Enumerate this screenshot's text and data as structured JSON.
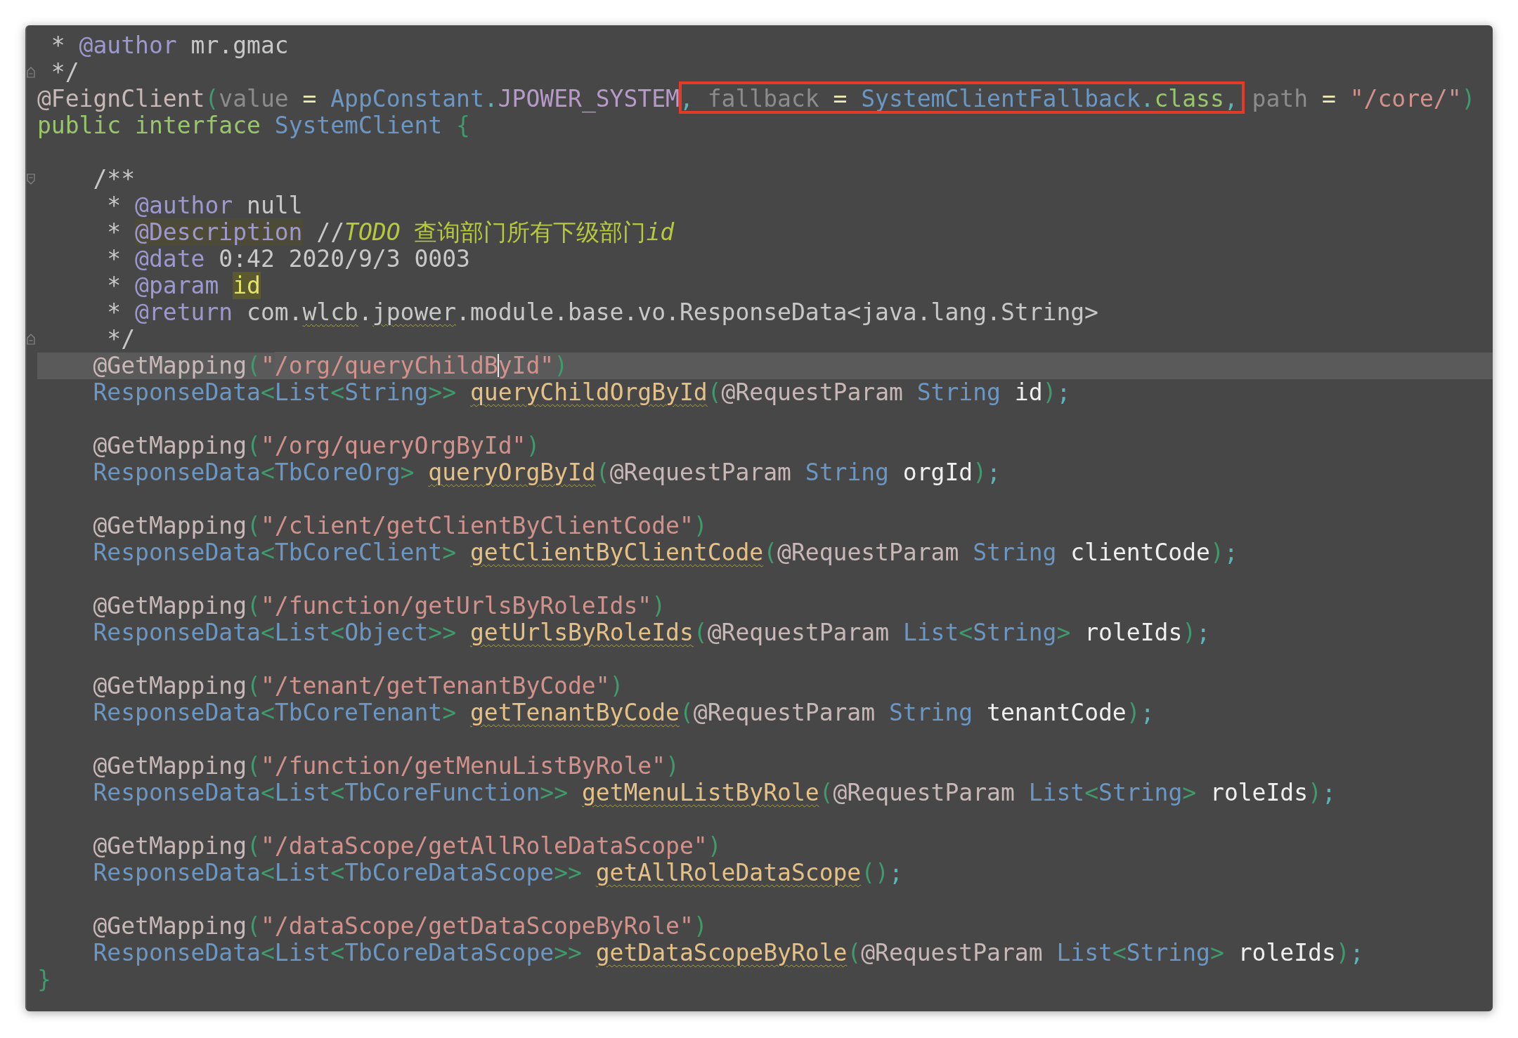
{
  "editor": {
    "lines": [
      {
        "kind": "code",
        "current": false,
        "tokens": [
          {
            "t": " * ",
            "kind": "doc"
          },
          {
            "t": "@author",
            "kind": "tag"
          },
          {
            "t": " mr.gmac",
            "kind": "doc"
          }
        ]
      },
      {
        "kind": "code",
        "current": false,
        "fold_end": true,
        "tokens": [
          {
            "t": " */",
            "kind": "doc"
          }
        ]
      },
      {
        "kind": "code",
        "current": false,
        "tokens": [
          {
            "t": "@FeignClient",
            "kind": "ann"
          },
          {
            "t": "(",
            "kind": "paren"
          },
          {
            "t": "value",
            "kind": "attr"
          },
          {
            "t": " = ",
            "kind": "op"
          },
          {
            "t": "AppConstant",
            "kind": "type"
          },
          {
            "t": ".",
            "kind": "dot"
          },
          {
            "t": "JPOWER_SYSTEM",
            "kind": "const"
          },
          {
            "kind": "group",
            "boxed": true,
            "tokens": [
              {
                "t": ",",
                "kind": "dot"
              },
              {
                "t": " fallback",
                "kind": "attr"
              },
              {
                "t": " = ",
                "kind": "op"
              },
              {
                "t": "SystemClientFallback",
                "kind": "type"
              },
              {
                "t": ".",
                "kind": "dot"
              },
              {
                "t": "class",
                "kind": "kw"
              },
              {
                "t": ",",
                "kind": "dot"
              }
            ]
          },
          {
            "t": " path",
            "kind": "attr"
          },
          {
            "t": " = ",
            "kind": "op"
          },
          {
            "t": "\"/core/\"",
            "kind": "str"
          },
          {
            "t": ")",
            "kind": "paren"
          }
        ]
      },
      {
        "kind": "code",
        "current": false,
        "tokens": [
          {
            "t": "public interface ",
            "kind": "kw"
          },
          {
            "t": "SystemClient ",
            "kind": "type"
          },
          {
            "t": "{",
            "kind": "paren"
          }
        ]
      },
      {
        "kind": "blank"
      },
      {
        "kind": "code",
        "current": false,
        "fold_start": true,
        "tokens": [
          {
            "t": "    /**",
            "kind": "doc"
          }
        ]
      },
      {
        "kind": "code",
        "current": false,
        "tokens": [
          {
            "t": "     * ",
            "kind": "doc"
          },
          {
            "t": "@author",
            "kind": "tag"
          },
          {
            "t": " null",
            "kind": "doc"
          }
        ]
      },
      {
        "kind": "code",
        "current": false,
        "tokens": [
          {
            "t": "     * ",
            "kind": "doc"
          },
          {
            "t": "@Description",
            "kind": "tag",
            "highlight": true
          },
          {
            "t": " //",
            "kind": "doc"
          },
          {
            "t": "TODO",
            "kind": "todo_i"
          },
          {
            "t": " 查询部门所有下级部门",
            "kind": "todo"
          },
          {
            "t": "id",
            "kind": "todo_i"
          }
        ]
      },
      {
        "kind": "code",
        "current": false,
        "tokens": [
          {
            "t": "     * ",
            "kind": "doc"
          },
          {
            "t": "@date",
            "kind": "tag"
          },
          {
            "t": " 0:42 2020/9/3 0003",
            "kind": "doc"
          }
        ]
      },
      {
        "kind": "code",
        "current": false,
        "tokens": [
          {
            "t": "     * ",
            "kind": "doc"
          },
          {
            "t": "@param ",
            "kind": "tag"
          },
          {
            "t": "id",
            "kind": "param",
            "highlight": true
          }
        ]
      },
      {
        "kind": "code",
        "current": false,
        "tokens": [
          {
            "t": "     * ",
            "kind": "doc"
          },
          {
            "t": "@return",
            "kind": "tag"
          },
          {
            "t": " com.",
            "kind": "doc"
          },
          {
            "t": "wlcb",
            "kind": "doc",
            "typo": true
          },
          {
            "t": ".",
            "kind": "doc"
          },
          {
            "t": "jpower",
            "kind": "doc",
            "typo": true
          },
          {
            "t": ".module.base.vo.ResponseData<java.lang.String>",
            "kind": "doc"
          }
        ]
      },
      {
        "kind": "code",
        "current": false,
        "fold_end": true,
        "tokens": [
          {
            "t": "     */",
            "kind": "doc"
          }
        ]
      },
      {
        "kind": "code",
        "current": true,
        "tokens": [
          {
            "t": "    @GetMapping",
            "kind": "ann"
          },
          {
            "t": "(",
            "kind": "paren"
          },
          {
            "t": "\"",
            "kind": "str"
          },
          {
            "t": "/org/queryChildB",
            "kind": "str",
            "highlight": true,
            "caret": true
          },
          {
            "t": "yId",
            "kind": "str",
            "highlight": true
          },
          {
            "t": "\"",
            "kind": "str"
          },
          {
            "t": ")",
            "kind": "paren"
          }
        ]
      },
      {
        "kind": "code",
        "current": false,
        "tokens": [
          {
            "t": "    ResponseData",
            "kind": "type"
          },
          {
            "t": "<",
            "kind": "paren"
          },
          {
            "t": "List",
            "kind": "type"
          },
          {
            "t": "<",
            "kind": "paren"
          },
          {
            "t": "String",
            "kind": "type"
          },
          {
            "t": ">> ",
            "kind": "paren"
          },
          {
            "t": "queryChildOrgById",
            "kind": "method",
            "typo": true
          },
          {
            "t": "(",
            "kind": "paren"
          },
          {
            "t": "@RequestParam ",
            "kind": "ann"
          },
          {
            "t": "String ",
            "kind": "type"
          },
          {
            "t": "id",
            "kind": "var"
          },
          {
            "t": ")",
            "kind": "paren"
          },
          {
            "t": ";",
            "kind": "dot"
          }
        ]
      },
      {
        "kind": "blank"
      },
      {
        "kind": "code",
        "current": false,
        "tokens": [
          {
            "t": "    @GetMapping",
            "kind": "ann"
          },
          {
            "t": "(",
            "kind": "paren"
          },
          {
            "t": "\"/org/queryOrgById\"",
            "kind": "str"
          },
          {
            "t": ")",
            "kind": "paren"
          }
        ]
      },
      {
        "kind": "code",
        "current": false,
        "tokens": [
          {
            "t": "    ResponseData",
            "kind": "type"
          },
          {
            "t": "<",
            "kind": "paren"
          },
          {
            "t": "TbCoreOrg",
            "kind": "type"
          },
          {
            "t": "> ",
            "kind": "paren"
          },
          {
            "t": "queryOrgById",
            "kind": "method",
            "typo": true
          },
          {
            "t": "(",
            "kind": "paren"
          },
          {
            "t": "@RequestParam ",
            "kind": "ann"
          },
          {
            "t": "String ",
            "kind": "type"
          },
          {
            "t": "orgId",
            "kind": "var"
          },
          {
            "t": ")",
            "kind": "paren"
          },
          {
            "t": ";",
            "kind": "dot"
          }
        ]
      },
      {
        "kind": "blank"
      },
      {
        "kind": "code",
        "current": false,
        "tokens": [
          {
            "t": "    @GetMapping",
            "kind": "ann"
          },
          {
            "t": "(",
            "kind": "paren"
          },
          {
            "t": "\"/client/getClientByClientCode\"",
            "kind": "str"
          },
          {
            "t": ")",
            "kind": "paren"
          }
        ]
      },
      {
        "kind": "code",
        "current": false,
        "tokens": [
          {
            "t": "    ResponseData",
            "kind": "type"
          },
          {
            "t": "<",
            "kind": "paren"
          },
          {
            "t": "TbCoreClient",
            "kind": "type"
          },
          {
            "t": "> ",
            "kind": "paren"
          },
          {
            "t": "getClientByClientCode",
            "kind": "method",
            "typo": true
          },
          {
            "t": "(",
            "kind": "paren"
          },
          {
            "t": "@RequestParam ",
            "kind": "ann"
          },
          {
            "t": "String ",
            "kind": "type"
          },
          {
            "t": "clientCode",
            "kind": "var"
          },
          {
            "t": ")",
            "kind": "paren"
          },
          {
            "t": ";",
            "kind": "dot"
          }
        ]
      },
      {
        "kind": "blank"
      },
      {
        "kind": "code",
        "current": false,
        "tokens": [
          {
            "t": "    @GetMapping",
            "kind": "ann"
          },
          {
            "t": "(",
            "kind": "paren"
          },
          {
            "t": "\"/function/getUrlsByRoleIds\"",
            "kind": "str"
          },
          {
            "t": ")",
            "kind": "paren"
          }
        ]
      },
      {
        "kind": "code",
        "current": false,
        "tokens": [
          {
            "t": "    ResponseData",
            "kind": "type"
          },
          {
            "t": "<",
            "kind": "paren"
          },
          {
            "t": "List",
            "kind": "type"
          },
          {
            "t": "<",
            "kind": "paren"
          },
          {
            "t": "Object",
            "kind": "type"
          },
          {
            "t": ">> ",
            "kind": "paren"
          },
          {
            "t": "getUrlsByRoleIds",
            "kind": "method",
            "typo": true
          },
          {
            "t": "(",
            "kind": "paren"
          },
          {
            "t": "@RequestParam ",
            "kind": "ann"
          },
          {
            "t": "List",
            "kind": "type"
          },
          {
            "t": "<",
            "kind": "paren"
          },
          {
            "t": "String",
            "kind": "type"
          },
          {
            "t": "> ",
            "kind": "paren"
          },
          {
            "t": "roleIds",
            "kind": "var"
          },
          {
            "t": ")",
            "kind": "paren"
          },
          {
            "t": ";",
            "kind": "dot"
          }
        ]
      },
      {
        "kind": "blank"
      },
      {
        "kind": "code",
        "current": false,
        "tokens": [
          {
            "t": "    @GetMapping",
            "kind": "ann"
          },
          {
            "t": "(",
            "kind": "paren"
          },
          {
            "t": "\"/tenant/getTenantByCode\"",
            "kind": "str"
          },
          {
            "t": ")",
            "kind": "paren"
          }
        ]
      },
      {
        "kind": "code",
        "current": false,
        "tokens": [
          {
            "t": "    ResponseData",
            "kind": "type"
          },
          {
            "t": "<",
            "kind": "paren"
          },
          {
            "t": "TbCoreTenant",
            "kind": "type"
          },
          {
            "t": "> ",
            "kind": "paren"
          },
          {
            "t": "getTenantByCode",
            "kind": "method",
            "typo": true
          },
          {
            "t": "(",
            "kind": "paren"
          },
          {
            "t": "@RequestParam ",
            "kind": "ann"
          },
          {
            "t": "String ",
            "kind": "type"
          },
          {
            "t": "tenantCode",
            "kind": "var"
          },
          {
            "t": ")",
            "kind": "paren"
          },
          {
            "t": ";",
            "kind": "dot"
          }
        ]
      },
      {
        "kind": "blank"
      },
      {
        "kind": "code",
        "current": false,
        "tokens": [
          {
            "t": "    @GetMapping",
            "kind": "ann"
          },
          {
            "t": "(",
            "kind": "paren"
          },
          {
            "t": "\"/function/getMenuListByRole\"",
            "kind": "str"
          },
          {
            "t": ")",
            "kind": "paren"
          }
        ]
      },
      {
        "kind": "code",
        "current": false,
        "tokens": [
          {
            "t": "    ResponseData",
            "kind": "type"
          },
          {
            "t": "<",
            "kind": "paren"
          },
          {
            "t": "List",
            "kind": "type"
          },
          {
            "t": "<",
            "kind": "paren"
          },
          {
            "t": "TbCoreFunction",
            "kind": "type"
          },
          {
            "t": ">> ",
            "kind": "paren"
          },
          {
            "t": "getMenuListByRole",
            "kind": "method",
            "typo": true
          },
          {
            "t": "(",
            "kind": "paren"
          },
          {
            "t": "@RequestParam ",
            "kind": "ann"
          },
          {
            "t": "List",
            "kind": "type"
          },
          {
            "t": "<",
            "kind": "paren"
          },
          {
            "t": "String",
            "kind": "type"
          },
          {
            "t": "> ",
            "kind": "paren"
          },
          {
            "t": "roleIds",
            "kind": "var"
          },
          {
            "t": ")",
            "kind": "paren"
          },
          {
            "t": ";",
            "kind": "dot"
          }
        ]
      },
      {
        "kind": "blank"
      },
      {
        "kind": "code",
        "current": false,
        "tokens": [
          {
            "t": "    @GetMapping",
            "kind": "ann"
          },
          {
            "t": "(",
            "kind": "paren"
          },
          {
            "t": "\"/dataScope/getAllRoleDataScope\"",
            "kind": "str"
          },
          {
            "t": ")",
            "kind": "paren"
          }
        ]
      },
      {
        "kind": "code",
        "current": false,
        "tokens": [
          {
            "t": "    ResponseData",
            "kind": "type"
          },
          {
            "t": "<",
            "kind": "paren"
          },
          {
            "t": "List",
            "kind": "type"
          },
          {
            "t": "<",
            "kind": "paren"
          },
          {
            "t": "TbCoreDataScope",
            "kind": "type"
          },
          {
            "t": ">> ",
            "kind": "paren"
          },
          {
            "t": "getAllRoleDataScope",
            "kind": "method",
            "typo": true
          },
          {
            "t": "()",
            "kind": "paren"
          },
          {
            "t": ";",
            "kind": "dot"
          }
        ]
      },
      {
        "kind": "blank"
      },
      {
        "kind": "code",
        "current": false,
        "tokens": [
          {
            "t": "    @GetMapping",
            "kind": "ann"
          },
          {
            "t": "(",
            "kind": "paren"
          },
          {
            "t": "\"/dataScope/getDataScopeByRole\"",
            "kind": "str"
          },
          {
            "t": ")",
            "kind": "paren"
          }
        ]
      },
      {
        "kind": "code",
        "current": false,
        "tokens": [
          {
            "t": "    ResponseData",
            "kind": "type"
          },
          {
            "t": "<",
            "kind": "paren"
          },
          {
            "t": "List",
            "kind": "type"
          },
          {
            "t": "<",
            "kind": "paren"
          },
          {
            "t": "TbCoreDataScope",
            "kind": "type"
          },
          {
            "t": ">> ",
            "kind": "paren"
          },
          {
            "t": "getDataScopeByRole",
            "kind": "method",
            "typo": true
          },
          {
            "t": "(",
            "kind": "paren"
          },
          {
            "t": "@RequestParam ",
            "kind": "ann"
          },
          {
            "t": "List",
            "kind": "type"
          },
          {
            "t": "<",
            "kind": "paren"
          },
          {
            "t": "String",
            "kind": "type"
          },
          {
            "t": "> ",
            "kind": "paren"
          },
          {
            "t": "roleIds",
            "kind": "var"
          },
          {
            "t": ")",
            "kind": "paren"
          },
          {
            "t": ";",
            "kind": "dot"
          }
        ]
      },
      {
        "kind": "code",
        "current": false,
        "tokens": [
          {
            "t": "}",
            "kind": "paren"
          }
        ]
      }
    ]
  }
}
